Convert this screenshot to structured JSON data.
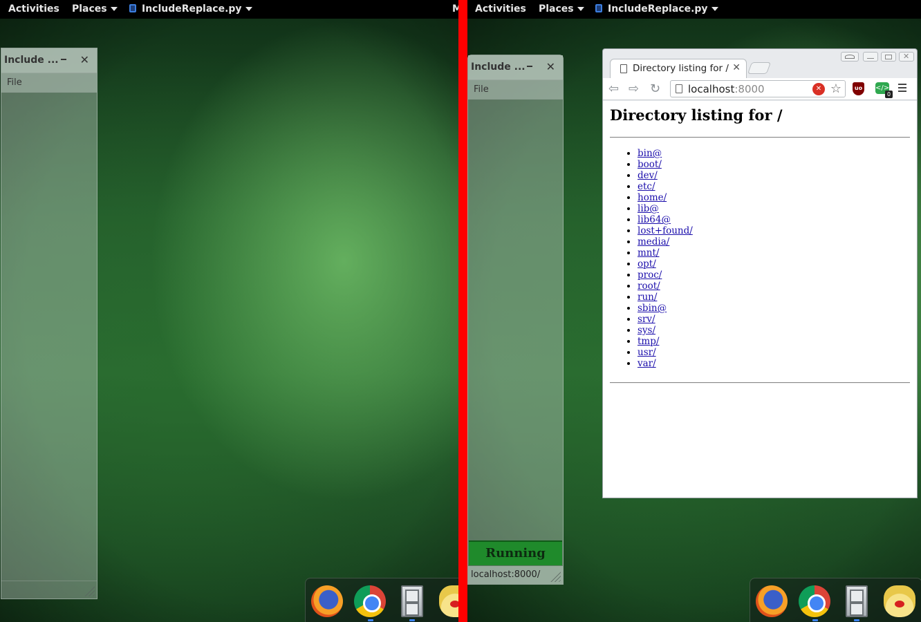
{
  "topbar": {
    "activities": "Activities",
    "places": "Places",
    "app_name": "IncludeReplace.py",
    "clipped_letter": "M"
  },
  "left_app": {
    "title": "Include ...",
    "menu_file": "File"
  },
  "right_app": {
    "title": "Include ...",
    "menu_file": "File",
    "status": "Running",
    "url": "localhost:8000/"
  },
  "browser": {
    "tab_title": "Directory listing for /",
    "url_host": "localhost",
    "url_port": ":8000",
    "ext_badge": "0",
    "heading": "Directory listing for /",
    "entries": [
      "bin@",
      "boot/",
      "dev/",
      "etc/",
      "home/",
      "lib@",
      "lib64@",
      "lost+found/",
      "media/",
      "mnt/",
      "opt/",
      "proc/",
      "root/",
      "run/",
      "sbin@",
      "srv/",
      "sys/",
      "tmp/",
      "usr/",
      "var/"
    ]
  },
  "dock": [
    "firefox-icon",
    "chrome-icon",
    "file-cabinet-icon",
    "teapot-icon"
  ],
  "colors": {
    "divider": "#ff0000",
    "running": "#1f8a2b",
    "link": "#1a0dab"
  }
}
